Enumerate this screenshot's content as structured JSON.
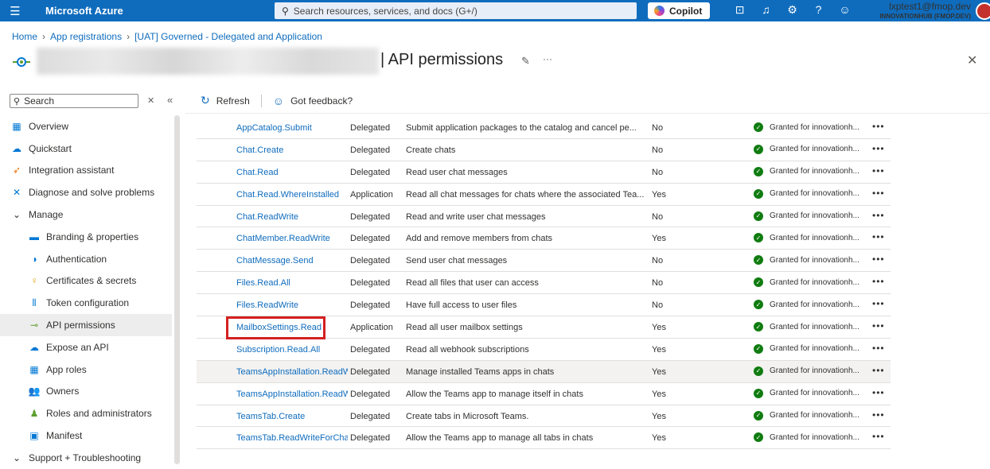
{
  "topbar": {
    "brand": "Microsoft Azure",
    "search_placeholder": "Search resources, services, and docs (G+/)",
    "copilot_label": "Copilot",
    "user_email": "lxptest1@fmop.dev",
    "user_tenant": "INNOVATIONHUB (FMOP.DEV)"
  },
  "breadcrumb": [
    "Home",
    "App registrations",
    "[UAT] Governed - Delegated and Application"
  ],
  "page": {
    "title": "| API permissions",
    "more": "···",
    "close": "✕"
  },
  "sidebar": {
    "search_placeholder": "Search",
    "items": [
      {
        "label": "Overview",
        "icon": "overview-icon",
        "level": 1
      },
      {
        "label": "Quickstart",
        "icon": "quickstart-icon",
        "level": 1
      },
      {
        "label": "Integration assistant",
        "icon": "rocket-icon",
        "level": 1
      },
      {
        "label": "Diagnose and solve problems",
        "icon": "wrench-icon",
        "level": 1
      },
      {
        "label": "Manage",
        "icon": "chevron-down-icon",
        "level": 1
      },
      {
        "label": "Branding & properties",
        "icon": "branding-icon",
        "level": 2
      },
      {
        "label": "Authentication",
        "icon": "authentication-icon",
        "level": 2
      },
      {
        "label": "Certificates & secrets",
        "icon": "key-icon",
        "level": 2
      },
      {
        "label": "Token configuration",
        "icon": "token-icon",
        "level": 2
      },
      {
        "label": "API permissions",
        "icon": "api-permissions-icon",
        "level": 2,
        "active": true
      },
      {
        "label": "Expose an API",
        "icon": "cloud-icon",
        "level": 2
      },
      {
        "label": "App roles",
        "icon": "app-roles-icon",
        "level": 2
      },
      {
        "label": "Owners",
        "icon": "owners-icon",
        "level": 2
      },
      {
        "label": "Roles and administrators",
        "icon": "roles-icon",
        "level": 2
      },
      {
        "label": "Manifest",
        "icon": "manifest-icon",
        "level": 2
      },
      {
        "label": "Support + Troubleshooting",
        "icon": "chevron-down-icon",
        "level": 1
      }
    ]
  },
  "toolbar": {
    "refresh": "Refresh",
    "feedback": "Got feedback?"
  },
  "permissions": [
    {
      "name": "AppCatalog.Submit",
      "type": "Delegated",
      "desc": "Submit application packages to the catalog and cancel pe...",
      "admin": "No",
      "status": "Granted for innovationh..."
    },
    {
      "name": "Chat.Create",
      "type": "Delegated",
      "desc": "Create chats",
      "admin": "No",
      "status": "Granted for innovationh..."
    },
    {
      "name": "Chat.Read",
      "type": "Delegated",
      "desc": "Read user chat messages",
      "admin": "No",
      "status": "Granted for innovationh..."
    },
    {
      "name": "Chat.Read.WhereInstalled",
      "type": "Application",
      "desc": "Read all chat messages for chats where the associated Tea...",
      "admin": "Yes",
      "status": "Granted for innovationh..."
    },
    {
      "name": "Chat.ReadWrite",
      "type": "Delegated",
      "desc": "Read and write user chat messages",
      "admin": "No",
      "status": "Granted for innovationh..."
    },
    {
      "name": "ChatMember.ReadWrite",
      "type": "Delegated",
      "desc": "Add and remove members from chats",
      "admin": "Yes",
      "status": "Granted for innovationh..."
    },
    {
      "name": "ChatMessage.Send",
      "type": "Delegated",
      "desc": "Send user chat messages",
      "admin": "No",
      "status": "Granted for innovationh..."
    },
    {
      "name": "Files.Read.All",
      "type": "Delegated",
      "desc": "Read all files that user can access",
      "admin": "No",
      "status": "Granted for innovationh..."
    },
    {
      "name": "Files.ReadWrite",
      "type": "Delegated",
      "desc": "Have full access to user files",
      "admin": "No",
      "status": "Granted for innovationh..."
    },
    {
      "name": "MailboxSettings.Read",
      "type": "Application",
      "desc": "Read all user mailbox settings",
      "admin": "Yes",
      "status": "Granted for innovationh..."
    },
    {
      "name": "Subscription.Read.All",
      "type": "Delegated",
      "desc": "Read all webhook subscriptions",
      "admin": "Yes",
      "status": "Granted for innovationh..."
    },
    {
      "name": "TeamsAppInstallation.ReadW",
      "type": "Delegated",
      "desc": "Manage installed Teams apps in chats",
      "admin": "Yes",
      "status": "Granted for innovationh...",
      "highlight": true
    },
    {
      "name": "TeamsAppInstallation.ReadW",
      "type": "Delegated",
      "desc": "Allow the Teams app to manage itself in chats",
      "admin": "Yes",
      "status": "Granted for innovationh..."
    },
    {
      "name": "TeamsTab.Create",
      "type": "Delegated",
      "desc": "Create tabs in Microsoft Teams.",
      "admin": "Yes",
      "status": "Granted for innovationh..."
    },
    {
      "name": "TeamsTab.ReadWriteForChat",
      "type": "Delegated",
      "desc": "Allow the Teams app to manage all tabs in chats",
      "admin": "Yes",
      "status": "Granted for innovationh..."
    }
  ],
  "colors": {
    "brand": "#0f6cbd",
    "granted": "#107c10",
    "callout": "#d42020"
  }
}
